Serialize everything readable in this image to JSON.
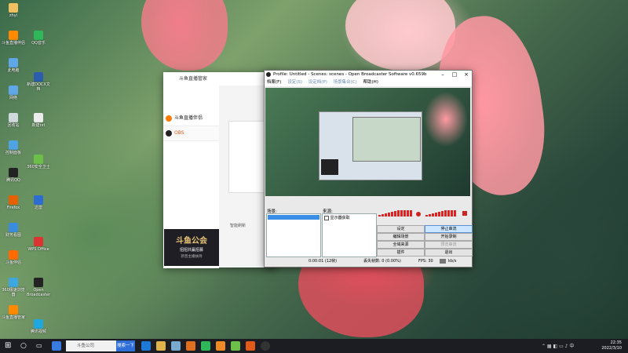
{
  "desktop_icons": [
    {
      "label": "zhyi",
      "color": "#f0c060"
    },
    {
      "label": "斗鱼直播伴侣",
      "color": "#ff8a00"
    },
    {
      "label": "此电脑",
      "color": "#5fa7e6"
    },
    {
      "label": "网络",
      "color": "#5fa7e6"
    },
    {
      "label": "回收站",
      "color": "#cfd8dc"
    },
    {
      "label": "控制面板",
      "color": "#4fa3e0"
    },
    {
      "label": "腾讯QQ",
      "color": "#222"
    },
    {
      "label": "Firefox",
      "color": "#e66000"
    },
    {
      "label": "财务看图",
      "color": "#3a8dde"
    },
    {
      "label": "斗鱼伴侣",
      "color": "#ff6a00"
    },
    {
      "label": "360极速浏览器",
      "color": "#3fa7e0"
    },
    {
      "label": "斗鱼直播管家",
      "color": "#ff8a00"
    },
    {
      "label": "QQ音乐",
      "color": "#2fb85a"
    },
    {
      "label": "新建DOCX文档",
      "color": "#2b5cad"
    },
    {
      "label": "新建txt",
      "color": "#ececec"
    },
    {
      "label": "360安全卫士",
      "color": "#6cc04a"
    },
    {
      "label": "迅雷",
      "color": "#2d6dd2"
    },
    {
      "label": "WPS Office",
      "color": "#d33"
    },
    {
      "label": "Open Broadcaster",
      "color": "#222"
    },
    {
      "label": "腾讯视频",
      "color": "#1fa8e0"
    }
  ],
  "douyu": {
    "title": "斗鱼直播管家",
    "menu_items": [
      {
        "label": "斗鱼直播伴侣",
        "color": "#ff7a00"
      },
      {
        "label": "OBS",
        "color": "#222"
      }
    ],
    "refresh": "智能刷新",
    "banner_title": "斗鱼公会",
    "banner_sub": "招招共赢招募",
    "banner_note": "新晋主播扶持"
  },
  "obs": {
    "title": "Profile: Untitled - Scenes: scenes - Open Broadcaster Software v0.659b",
    "menu": [
      "档案(F)",
      "设定(S)",
      "设定档(P)",
      "场景集合(C)",
      "帮助(H)"
    ],
    "scenes_label": "场景:",
    "sources_label": "来源:",
    "source_item": "显示器获取",
    "buttons_left": [
      "设定",
      "编辑场景",
      "全域来源",
      "插件"
    ],
    "buttons_right": [
      "停止串流",
      "开始录制",
      "预览串流",
      "退出"
    ],
    "status_time": "0:00:01 (12帧)",
    "status_dropped": "丢失帧数: 0 (0.00%)",
    "status_fps": "FPS: 30",
    "status_kbs": "kb/s"
  },
  "taskbar": {
    "search_placeholder": "斗鱼公司",
    "search_button": "搜索一下",
    "time": "22:35",
    "date": "2022/3/10"
  },
  "colors": {
    "accent": "#2f6ed6",
    "obs_meter": "#d22",
    "douyu_orange": "#ff7a00"
  }
}
